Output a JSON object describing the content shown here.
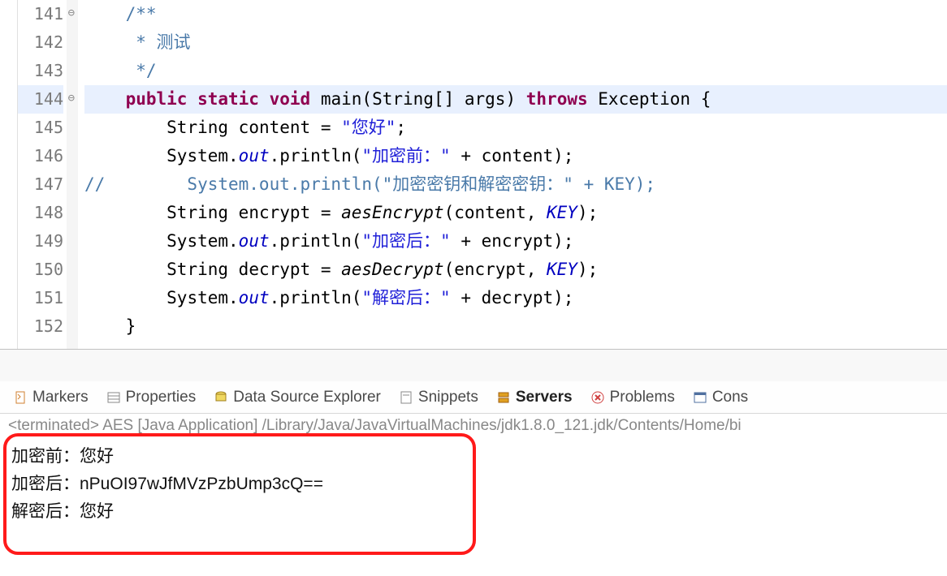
{
  "gutter": [
    "141",
    "142",
    "143",
    "144",
    "145",
    "146",
    "147",
    "148",
    "149",
    "150",
    "151",
    "152"
  ],
  "code": {
    "l141": {
      "comment_open": "/**"
    },
    "l142": {
      "comment_body": " * 测试"
    },
    "l143": {
      "comment_close": " */"
    },
    "l144": {
      "kw_public": "public",
      "kw_static": "static",
      "kw_void": "void",
      "method": "main",
      "lparen": "(",
      "type_string": "String",
      "brackets": "[]",
      "args": " args",
      "rparen": ")",
      "kw_throws": "throws",
      "exception": "Exception",
      "brace": " {"
    },
    "l145": {
      "indent": "        ",
      "type": "String ",
      "var": "content",
      "eq": " = ",
      "str": "\"您好\"",
      "semi": ";"
    },
    "l146": {
      "indent": "        ",
      "sys": "System.",
      "out": "out",
      "dot": ".println(",
      "str": "\"加密前：\"",
      "plus": " + content);"
    },
    "l147": {
      "comment": "//        System.out.println(\"加密密钥和解密密钥：\" + KEY);"
    },
    "l148": {
      "indent": "        ",
      "type": "String ",
      "var": "encrypt",
      "eq": " = ",
      "call": "aesEncrypt",
      "lparen": "(content, ",
      "key": "KEY",
      "rparen": ");"
    },
    "l149": {
      "indent": "        ",
      "sys": "System.",
      "out": "out",
      "dot": ".println(",
      "str": "\"加密后：\"",
      "plus": " + encrypt);"
    },
    "l150": {
      "indent": "        ",
      "type": "String ",
      "var": "decrypt",
      "eq": " = ",
      "call": "aesDecrypt",
      "lparen": "(encrypt, ",
      "key": "KEY",
      "rparen": ");"
    },
    "l151": {
      "indent": "        ",
      "sys": "System.",
      "out": "out",
      "dot": ".println(",
      "str": "\"解密后：\"",
      "plus": " + decrypt);"
    },
    "l152": {
      "brace": "    }"
    }
  },
  "tabs": {
    "markers": "Markers",
    "properties": "Properties",
    "dse": "Data Source Explorer",
    "snippets": "Snippets",
    "servers": "Servers",
    "problems": "Problems",
    "console": "Cons"
  },
  "console": {
    "header": "<terminated> AES [Java Application] /Library/Java/JavaVirtualMachines/jdk1.8.0_121.jdk/Contents/Home/bi",
    "line1": "加密前：您好",
    "line2": "加密后：nPuOI97wJfMVzPzbUmp3cQ==",
    "line3": "解密后：您好"
  }
}
